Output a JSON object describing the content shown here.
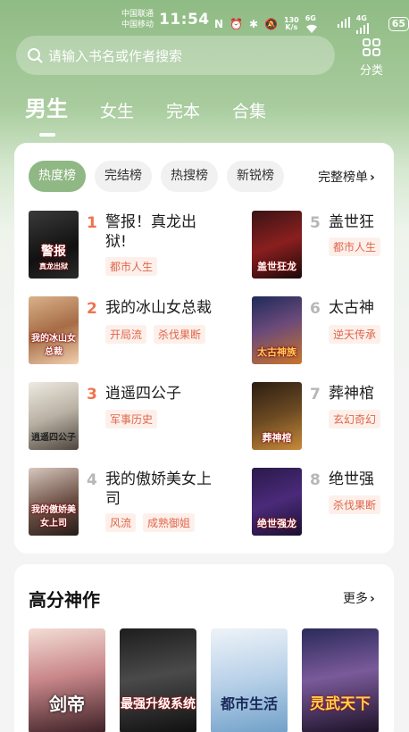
{
  "status": {
    "carrier1": "中国联通",
    "carrier2": "中国移动",
    "time": "11:54",
    "speed_value": "130",
    "speed_unit": "K/s",
    "wifi_label": "6G",
    "signal_label": "4G",
    "battery": "65"
  },
  "search": {
    "placeholder": "请输入书名或作者搜索"
  },
  "category": {
    "label": "分类"
  },
  "gender_tabs": [
    "男生",
    "女生",
    "完本",
    "合集"
  ],
  "rank_tabs": [
    "热度榜",
    "完结榜",
    "热搜榜",
    "新锐榜"
  ],
  "full_rank_label": "完整榜单",
  "books": [
    {
      "rank": "1",
      "title": "警报！真龙出狱!",
      "tags": [
        "都市人生"
      ],
      "cover_text": "警报",
      "cover_sub": "真龙出狱"
    },
    {
      "rank": "2",
      "title": "我的冰山女总裁",
      "tags": [
        "开局流",
        "杀伐果断"
      ],
      "cover_text": "我的冰山女总裁"
    },
    {
      "rank": "3",
      "title": "逍遥四公子",
      "tags": [
        "军事历史"
      ],
      "cover_text": "逍遥四公子"
    },
    {
      "rank": "4",
      "title": "我的傲娇美女上司",
      "tags": [
        "风流",
        "成熟御姐"
      ],
      "cover_text": "我的傲娇美女上司"
    },
    {
      "rank": "5",
      "title": "盖世狂",
      "tags": [
        "都市人生"
      ],
      "cover_text": "盖世狂龙"
    },
    {
      "rank": "6",
      "title": "太古神",
      "tags": [
        "逆天传承"
      ],
      "cover_text": "太古神族"
    },
    {
      "rank": "7",
      "title": "葬神棺",
      "tags": [
        "玄幻奇幻"
      ],
      "cover_text": "葬神棺"
    },
    {
      "rank": "8",
      "title": "绝世强",
      "tags": [
        "杀伐果断"
      ],
      "cover_text": "绝世强龙"
    }
  ],
  "section2": {
    "title": "高分神作",
    "more": "更多",
    "covers": [
      "剑帝",
      "最强升级系统",
      "都市生活",
      "灵武天下"
    ]
  },
  "colors": {
    "accent": "#8fb884",
    "rank_top": "#f0734f",
    "rank_other": "#b7b7b7",
    "tag_text": "#e0664c",
    "tag_bg": "#fdf0ea"
  }
}
